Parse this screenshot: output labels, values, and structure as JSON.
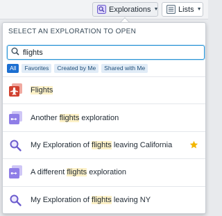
{
  "toolbar": {
    "explorations_label": "Explorations",
    "lists_label": "Lists"
  },
  "popover": {
    "title": "SELECT AN EXPLORATION TO OPEN",
    "search": {
      "value": "flights",
      "placeholder": ""
    },
    "filters": [
      {
        "label": "All",
        "active": true
      },
      {
        "label": "Favorites",
        "active": false
      },
      {
        "label": "Created by Me",
        "active": false
      },
      {
        "label": "Shared with Me",
        "active": false
      }
    ],
    "items": [
      {
        "icon": "airplane-icon",
        "pre": "",
        "match": "Flights",
        "post": "",
        "favorite": false
      },
      {
        "icon": "object-link-icon",
        "pre": "Another ",
        "match": "flights",
        "post": " exploration",
        "favorite": false
      },
      {
        "icon": "search-exploration-icon",
        "pre": "My Exploration of ",
        "match": "flights",
        "post": " leaving California",
        "favorite": true
      },
      {
        "icon": "object-link-icon",
        "pre": "A different ",
        "match": "flights",
        "post": " exploration",
        "favorite": false
      },
      {
        "icon": "search-exploration-icon",
        "pre": "My Exploration of ",
        "match": "flights",
        "post": " leaving NY",
        "favorite": false
      }
    ]
  },
  "colors": {
    "accent": "#1c6fd1",
    "highlight": "#fdf1c7",
    "star": "#f2b600",
    "airplane_bg": "#d1412f",
    "link_icon": "#8f7ee7"
  }
}
